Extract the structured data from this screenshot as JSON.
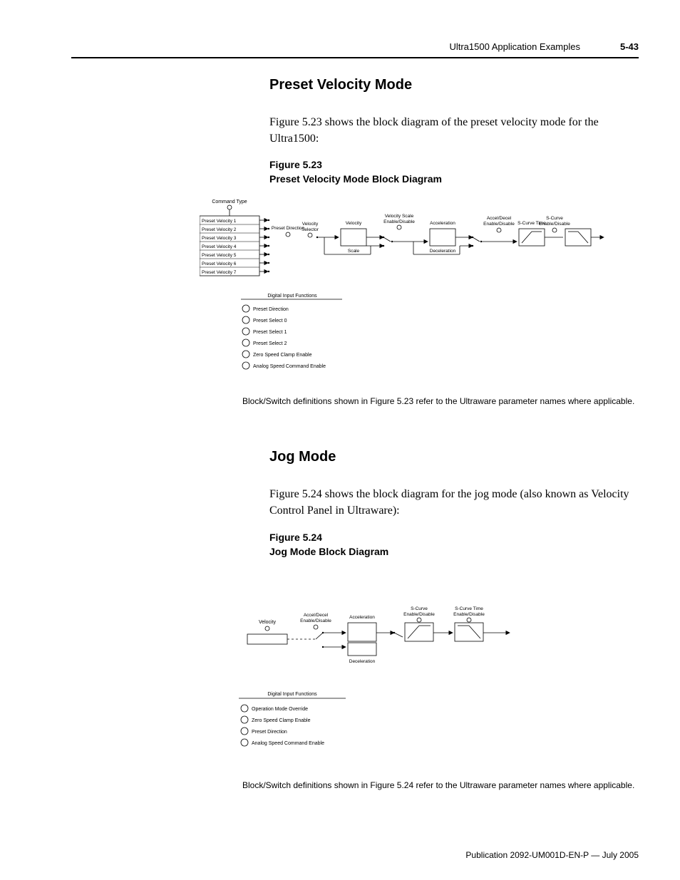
{
  "header": {
    "title": "Ultra1500 Application Examples",
    "page": "5-43"
  },
  "sec1": {
    "heading": "Preset Velocity Mode",
    "body": "Figure 5.23 shows the block diagram of the preset velocity mode for the Ultra1500:",
    "fig_num": "Figure 5.23",
    "fig_title": "Preset Velocity Mode Block Diagram",
    "note": "Block/Switch definitions shown in Figure 5.23 refer to the Ultraware parameter names where applicable."
  },
  "sec2": {
    "heading": "Jog Mode",
    "body": "Figure 5.24 shows the block diagram for the jog mode (also known as Velocity Control Panel in Ultraware):",
    "fig_num": "Figure 5.24",
    "fig_title": "Jog Mode Block Diagram",
    "note": "Block/Switch definitions shown in Figure 5.24 refer to the Ultraware parameter names where applicable."
  },
  "footer": {
    "pub": "Publication 2092-UM001D-EN-P — July 2005"
  },
  "diagram1": {
    "command_type": "Command Type",
    "presets": [
      "Preset Velocity 1",
      "Preset Velocity 2",
      "Preset Velocity 3",
      "Preset Velocity 4",
      "Preset Velocity 5",
      "Preset Velocity 6",
      "Preset Velocity 7"
    ],
    "preset_dir": "Preset Direction",
    "selector": "Velocity\nSelector",
    "scale_label": "Velocity\nScale",
    "scale_sw": "Velocity Scale\nEnable/Disable",
    "accel": "Acceleration",
    "decel": "Deceleration",
    "slimit": "S-Curve Time",
    "accel_sw": "Accel/Decel\nEnable/Disable",
    "slimit_sw": "S-Curve\nEnable/Disable",
    "digital_in_title": "Digital Input Functions",
    "digital_inputs": [
      "Preset Direction",
      "Preset Select 0",
      "Preset Select 1",
      "Preset Select 2",
      "Zero Speed Clamp Enable",
      "Analog Speed Command Enable"
    ]
  },
  "diagram2": {
    "velocity": "Velocity",
    "accel": "Acceleration",
    "decel": "Deceleration",
    "slimit": "S-Curve Time",
    "accel_sw": "Accel/Decel\nEnable/Disable",
    "slimit_sw": "S-Curve\nEnable/Disable",
    "digital_in_title": "Digital Input Functions",
    "digital_inputs": [
      "Operation Mode Override",
      "Zero Speed Clamp Enable",
      "Preset Direction",
      "Analog Speed Command Enable"
    ]
  }
}
